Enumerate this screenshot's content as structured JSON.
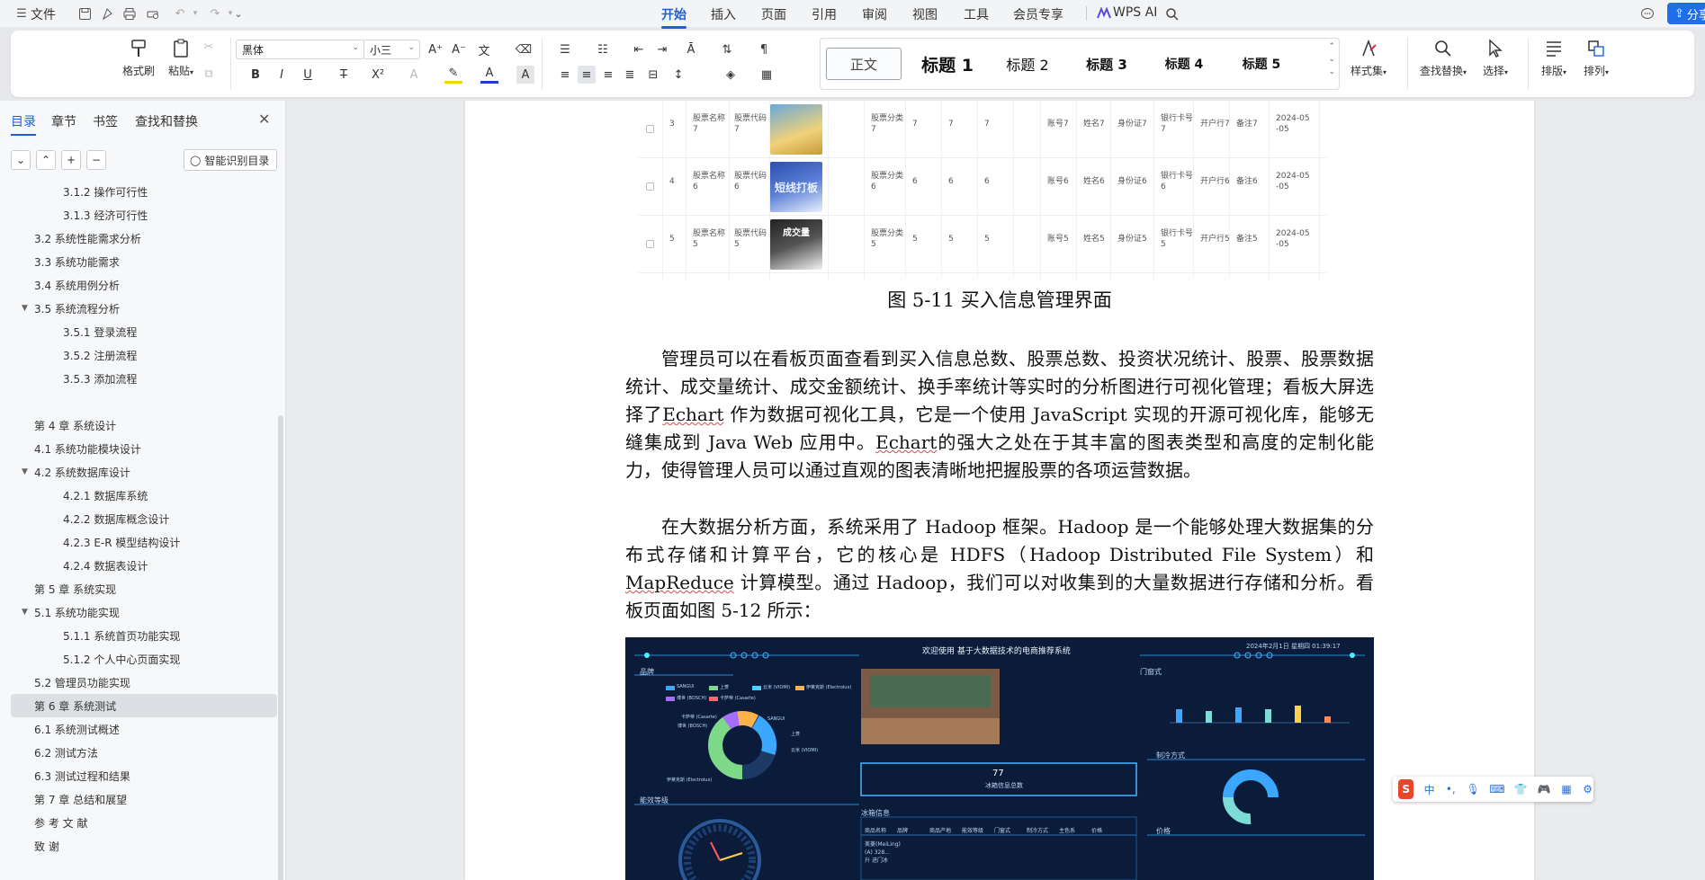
{
  "menubar": {
    "file_label": "文件",
    "tabs": [
      {
        "label": "开始",
        "active": true
      },
      {
        "label": "插入"
      },
      {
        "label": "页面"
      },
      {
        "label": "引用"
      },
      {
        "label": "审阅"
      },
      {
        "label": "视图"
      },
      {
        "label": "工具"
      },
      {
        "label": "会员专享"
      }
    ],
    "wps_ai_label": "WPS AI",
    "share_label": "分享"
  },
  "ribbon": {
    "format_painter_label": "格式刷",
    "paste_label": "粘贴",
    "font_name": "黑体",
    "font_size": "小三",
    "styles": [
      "正文",
      "标题 1",
      "标题 2",
      "标题 3",
      "标题 4",
      "标题 5"
    ],
    "style_set_label": "样式集",
    "find_replace_label": "查找替换",
    "select_label": "选择",
    "layout_label": "排版",
    "arrange_label": "排列"
  },
  "navpane": {
    "tabs": [
      "目录",
      "章节",
      "书签",
      "查找和替换"
    ],
    "smart_toc_label": "智能识别目录",
    "toc": [
      {
        "label": "3.1.2  操作可行性",
        "level": 3
      },
      {
        "label": "3.1.3  经济可行性",
        "level": 3
      },
      {
        "label": "3.2 系统性能需求分析",
        "level": 2
      },
      {
        "label": "3.3 系统功能需求",
        "level": 2
      },
      {
        "label": "3.4  系统用例分析",
        "level": 2
      },
      {
        "label": "3.5  系统流程分析",
        "level": 2,
        "expanded": true
      },
      {
        "label": "3.5.1  登录流程",
        "level": 3
      },
      {
        "label": "3.5.2  注册流程",
        "level": 3
      },
      {
        "label": "3.5.3  添加流程",
        "level": 3
      },
      {
        "label": "",
        "level": 0
      },
      {
        "label": "第 4 章  系统设计",
        "level": 1
      },
      {
        "label": "4.1 系统功能模块设计",
        "level": 2
      },
      {
        "label": "4.2  系统数据库设计",
        "level": 2,
        "expanded": true
      },
      {
        "label": "4.2.1  数据库系统",
        "level": 3
      },
      {
        "label": "4.2.2  数据库概念设计",
        "level": 3
      },
      {
        "label": "4.2.3 E-R 模型结构设计",
        "level": 3
      },
      {
        "label": "4.2.4 数据表设计",
        "level": 3
      },
      {
        "label": "第 5 章  系统实现",
        "level": 1
      },
      {
        "label": "5.1 系统功能实现",
        "level": 2,
        "expanded": true
      },
      {
        "label": "5.1.1 系统首页功能实现",
        "level": 3
      },
      {
        "label": "5.1.2 个人中心页面实现",
        "level": 3
      },
      {
        "label": "5.2 管理员功能实现",
        "level": 2
      },
      {
        "label": "第 6 章    系统测试",
        "level": 1,
        "active": true
      },
      {
        "label": "6.1  系统测试概述",
        "level": 2
      },
      {
        "label": "6.2  测试方法",
        "level": 2
      },
      {
        "label": "6.3  测试过程和结果",
        "level": 2
      },
      {
        "label": "第 7 章  总结和展望",
        "level": 1
      },
      {
        "label": "参  考  文  献",
        "level": 1
      },
      {
        "label": "致    谢",
        "level": 1
      }
    ]
  },
  "document": {
    "table_rows": [
      {
        "idx": "3",
        "name": "股票名称\n7",
        "code": "股票代码\n7",
        "cat": "股票分类\n7",
        "v1": "7",
        "v2": "7",
        "v3": "7",
        "acct": "账号7",
        "person": "姓名7",
        "id": "身份证7",
        "card": "银行卡号\n7",
        "bank": "开户行7",
        "note": "备注7",
        "date": "2024-05\n-05"
      },
      {
        "idx": "4",
        "name": "股票名称\n6",
        "code": "股票代码\n6",
        "cat": "股票分类\n6",
        "v1": "6",
        "v2": "6",
        "v3": "6",
        "acct": "账号6",
        "person": "姓名6",
        "id": "身份证6",
        "card": "银行卡号\n6",
        "bank": "开户行6",
        "note": "备注6",
        "date": "2024-05\n-05"
      },
      {
        "idx": "5",
        "name": "股票名称\n5",
        "code": "股票代码\n5",
        "cat": "股票分类\n5",
        "v1": "5",
        "v2": "5",
        "v3": "5",
        "acct": "账号5",
        "person": "姓名5",
        "id": "身份证5",
        "card": "银行卡号\n5",
        "bank": "开户行5",
        "note": "备注5",
        "date": "2024-05\n-05"
      }
    ],
    "thumb_texts": [
      "短线打板",
      "成交量"
    ],
    "caption": "图 5-11 买入信息管理界面",
    "para1_a": "管理员可以在看板页面查看到买入信息总数、股票总数、投资状况统计、股票、股票数据统计、成交量统计、成交金额统计、换手率统计等实时的分析图进行可视化管理；看板大屏选择了",
    "para1_echart1": "Echart",
    "para1_b": " 作为数据可视化工具，它是一个使用 JavaScript 实现的开源可视化库，能够无缝集成到 Java Web 应用中。",
    "para1_echart2": "Echart",
    "para1_c": "的强大之处在于其丰富的图表类型和高度的定制化能力，使得管理人员可以通过直观的图表清晰地把握股票的各项运营数据。",
    "para2_a": "在大数据分析方面，系统采用了 Hadoop 框架。Hadoop 是一个能够处理大数据集的分布式存储和计算平台，它的核心是 HDFS（Hadoop Distributed File System）和 ",
    "para2_mr": "MapReduce",
    "para2_b": " 计算模型。通过 Hadoop，我们可以对收集到的大量数据进行存储和分析。看板页面如图 5-12 所示：",
    "dash": {
      "title": "欢迎使用 基于大数据技术的电商推荐系统",
      "datetime": "2024年2月1日 星期四 01:39:17",
      "p1_title": "品牌",
      "p2_title": "门窗式",
      "p3_title": "制冷方式",
      "p4_title": "能效等级",
      "p5_title": "冰箱信息",
      "p6_title": "价格",
      "center_value": "77",
      "center_label": "冰箱信息总数",
      "table_headers": [
        "商品名称",
        "品牌",
        "商品产地",
        "能效等级",
        "门窗式",
        "制冷方式",
        "主色系",
        "价格"
      ],
      "legend": [
        "SANGUI",
        "上菱",
        "云米 (VIOMI)",
        "伊莱克斯 (Electrolux)",
        "博世 (BOSCH)",
        "卡萨帝 (Casarte)"
      ],
      "donut_labels": [
        "卡萨帝 (Casarte)",
        "博世 (BOSCH)",
        "SANGUI",
        "上菱",
        "云米 (VIOMI)",
        "伊莱克斯 (Electrolux)"
      ],
      "row_sample": "美菱(MeiLing)\n(A) 328...\n升 进门冰"
    }
  },
  "colors": {
    "accent": "#1f5fd6",
    "share_bg": "#1f6feb",
    "dash_bg": "#0b1b3a"
  }
}
